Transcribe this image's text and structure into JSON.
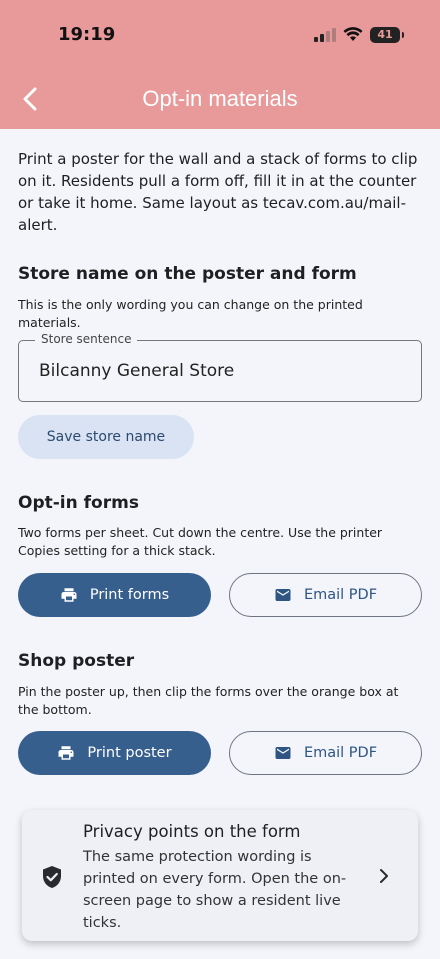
{
  "status_bar": {
    "time": "19:19",
    "battery": "41"
  },
  "header": {
    "title": "Opt-in materials"
  },
  "intro": "Print a poster for the wall and a stack of forms to clip on it. Residents pull a form off, fill it in at the counter or take it home. Same layout as tecav.com.au/mail-alert.",
  "store": {
    "heading": "Store name on the poster and form",
    "description": "This is the only wording you can change on the printed materials.",
    "field_label": "Store sentence",
    "field_value": "Bilcanny General Store",
    "save_label": "Save store name"
  },
  "forms": {
    "heading": "Opt-in forms",
    "description": "Two forms per sheet. Cut down the centre. Use the printer Copies setting for a thick stack.",
    "print_label": "Print forms",
    "email_label": "Email PDF"
  },
  "poster": {
    "heading": "Shop poster",
    "description": "Pin the poster up, then clip the forms over the orange box at the bottom.",
    "print_label": "Print poster",
    "email_label": "Email PDF"
  },
  "privacy_card": {
    "title": "Privacy points on the form",
    "body": "The same protection wording is printed on every form. Open the on-screen page to show a resident live ticks."
  },
  "colors": {
    "header": "#e8999a",
    "primary": "#365f8e",
    "tonal": "#d9e3f3"
  }
}
